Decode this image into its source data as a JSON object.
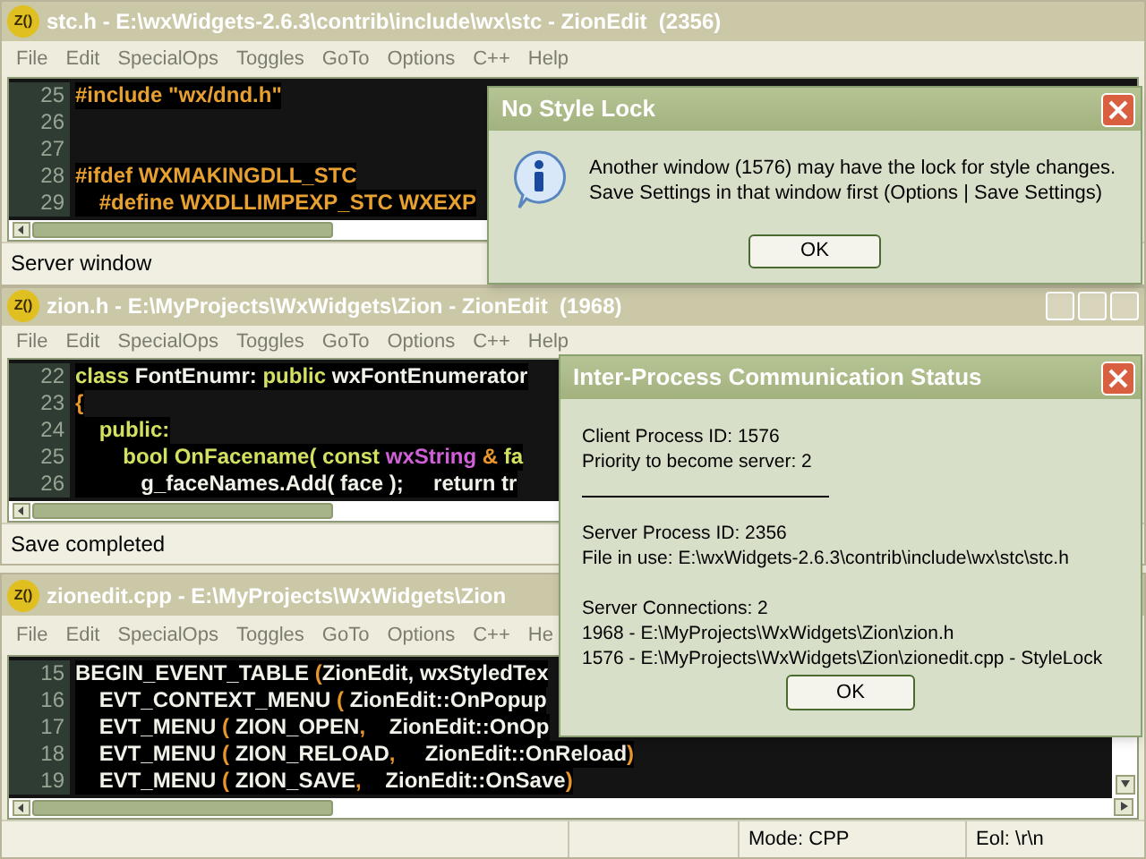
{
  "windows": [
    {
      "logo": "Z()",
      "title": "stc.h - E:\\wxWidgets-2.6.3\\contrib\\include\\wx\\stc - ZionEdit  (2356)",
      "menu": [
        "File",
        "Edit",
        "SpecialOps",
        "Toggles",
        "GoTo",
        "Options",
        "C++",
        "Help"
      ],
      "lines": [
        {
          "number": "25",
          "tokens": [
            {
              "text": "#include \"wx/dnd.h\"",
              "kind": "preproc"
            }
          ]
        },
        {
          "number": "26"
        },
        {
          "number": "27"
        },
        {
          "number": "28",
          "tokens": [
            {
              "text": "#ifdef WXMAKINGDLL_STC",
              "kind": "preproc"
            }
          ]
        },
        {
          "number": "29",
          "tokens": [
            {
              "text": "    #define WXDLLIMPEXP_STC WXEXP",
              "kind": "preproc"
            }
          ]
        }
      ],
      "status": [
        "Server window"
      ]
    },
    {
      "logo": "Z()",
      "title": "zion.h - E:\\MyProjects\\WxWidgets\\Zion - ZionEdit  (1968)",
      "menu": [
        "File",
        "Edit",
        "SpecialOps",
        "Toggles",
        "GoTo",
        "Options",
        "C++",
        "Help"
      ],
      "lines": [
        {
          "number": "22",
          "tokens": [
            {
              "text": "class ",
              "kind": "keyword"
            },
            {
              "text": "FontEnumr: ",
              "kind": "ident"
            },
            {
              "text": "public ",
              "kind": "keyword"
            },
            {
              "text": "wxFontEnumerator",
              "kind": "ident"
            }
          ]
        },
        {
          "number": "23",
          "tokens": [
            {
              "text": "{",
              "kind": "punct"
            }
          ]
        },
        {
          "number": "24",
          "tokens": [
            {
              "text": "    public:",
              "kind": "keyword"
            }
          ]
        },
        {
          "number": "25",
          "tokens": [
            {
              "text": "        bool ",
              "kind": "keyword"
            },
            {
              "text": "OnFacename( ",
              "kind": "keyword"
            },
            {
              "text": "const ",
              "kind": "keyword"
            },
            {
              "text": "wxString ",
              "kind": "type"
            },
            {
              "text": "& ",
              "kind": "punct"
            },
            {
              "text": "fa",
              "kind": "keyword"
            }
          ]
        },
        {
          "number": "26",
          "tokens": [
            {
              "text": "           g_faceNames.Add( face );     return tr",
              "kind": "ident"
            }
          ]
        }
      ],
      "status": [
        "Save completed"
      ]
    },
    {
      "logo": "Z()",
      "title": "zionedit.cpp - E:\\MyProjects\\WxWidgets\\Zion",
      "menu": [
        "File",
        "Edit",
        "SpecialOps",
        "Toggles",
        "GoTo",
        "Options",
        "C++",
        "He"
      ],
      "lines": [
        {
          "number": "15",
          "tokens": [
            {
              "text": "BEGIN_EVENT_TABLE ",
              "kind": "ident"
            },
            {
              "text": "(",
              "kind": "punct"
            },
            {
              "text": "ZionEdit, wxStyledTex",
              "kind": "ident"
            }
          ]
        },
        {
          "number": "16",
          "tokens": [
            {
              "text": "    EVT_CONTEXT_MENU ",
              "kind": "ident"
            },
            {
              "text": "( ",
              "kind": "punct"
            },
            {
              "text": "ZionEdit::OnPopup",
              "kind": "ident"
            }
          ]
        },
        {
          "number": "17",
          "tokens": [
            {
              "text": "    EVT_MENU ",
              "kind": "ident"
            },
            {
              "text": "( ",
              "kind": "punct"
            },
            {
              "text": "ZION_OPEN",
              "kind": "ident"
            },
            {
              "text": ",    ",
              "kind": "punct"
            },
            {
              "text": "ZionEdit::OnOp",
              "kind": "ident"
            }
          ]
        },
        {
          "number": "18",
          "tokens": [
            {
              "text": "    EVT_MENU ",
              "kind": "ident"
            },
            {
              "text": "( ",
              "kind": "punct"
            },
            {
              "text": "ZION_RELOAD",
              "kind": "ident"
            },
            {
              "text": ",     ",
              "kind": "punct"
            },
            {
              "text": "ZionEdit::OnReload",
              "kind": "ident"
            },
            {
              "text": ")",
              "kind": "punct"
            }
          ]
        },
        {
          "number": "19",
          "tokens": [
            {
              "text": "    EVT_MENU ",
              "kind": "ident"
            },
            {
              "text": "( ",
              "kind": "punct"
            },
            {
              "text": "ZION_SAVE",
              "kind": "ident"
            },
            {
              "text": ",    ",
              "kind": "punct"
            },
            {
              "text": "ZionEdit::OnSave",
              "kind": "ident"
            },
            {
              "text": ")",
              "kind": "punct"
            }
          ]
        }
      ],
      "status": [
        "Mode: CPP",
        "Eol: \\r\\n"
      ]
    }
  ],
  "dialogs": [
    {
      "title": "No Style Lock",
      "sections": [
        [
          "Another window (1576) may have the lock for style changes.",
          "Save Settings in that window first (Options | Save Settings)"
        ]
      ],
      "button": "OK"
    },
    {
      "title": "Inter-Process Communication Status",
      "sections": [
        [
          "Client Process ID: 1576",
          "Priority to become server: 2"
        ],
        [
          "Server Process ID: 2356",
          "File in use: E:\\wxWidgets-2.6.3\\contrib\\include\\wx\\stc\\stc.h"
        ],
        [
          "Server Connections: 2",
          "1968 - E:\\MyProjects\\WxWidgets\\Zion\\zion.h",
          "1576 - E:\\MyProjects\\WxWidgets\\Zion\\zionedit.cpp - StyleLock"
        ]
      ],
      "button": "OK"
    }
  ]
}
